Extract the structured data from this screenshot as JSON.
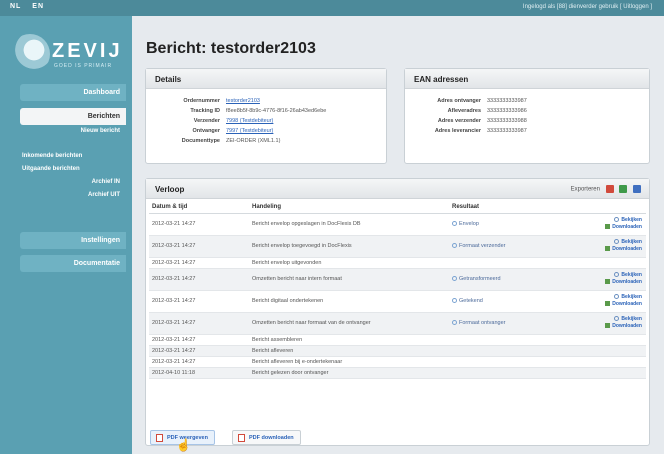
{
  "topbar": {
    "languages": [
      "NL",
      "EN"
    ],
    "userinfo": "Ingelogd als [88] dienverder gebruik [ Uitloggen ]"
  },
  "logo": {
    "name": "ZEVIJ",
    "tagline": "GOED IS PRIMAIR"
  },
  "sidebar": {
    "dashboard": "Dashboard",
    "berichten": "Berichten",
    "nieuw_bericht": "Nieuw bericht",
    "inkomende": "Inkomende berichten",
    "uitgaande": "Uitgaande berichten",
    "archief_in": "Archief IN",
    "archief_uit": "Archief UIT",
    "instellingen": "Instellingen",
    "documentatie": "Documentatie"
  },
  "page_title": "Bericht: testorder2103",
  "details": {
    "heading": "Details",
    "rows": [
      {
        "key": "Ordernummer",
        "value": "testorder2103",
        "link": true
      },
      {
        "key": "Tracking ID",
        "value": "f8ee8b5f-8b9c-4776-8f16-26ab43ed6ebe",
        "link": false
      },
      {
        "key": "Verzender",
        "value": "7998 (Testdebiteur)",
        "link": true
      },
      {
        "key": "Ontvanger",
        "value": "7997 (Testdebiteur)",
        "link": true
      },
      {
        "key": "Documenttype",
        "value": "ZEI-ORDER (XML1.1)",
        "link": false
      }
    ]
  },
  "ean": {
    "heading": "EAN adressen",
    "rows": [
      {
        "key": "Adres ontvanger",
        "value": "3333333333987"
      },
      {
        "key": "Afleveradres",
        "value": "3333333333986"
      },
      {
        "key": "Adres verzender",
        "value": "3333333333988"
      },
      {
        "key": "Adres leverancier",
        "value": "3333333333987"
      }
    ]
  },
  "verloop": {
    "heading": "Verloop",
    "export_label": "Exporteren",
    "columns": [
      "Datum & tijd",
      "Handeling",
      "Resultaat"
    ],
    "rows": [
      {
        "date": "2012-03-21 14:27",
        "action": "Bericht envelop opgeslagen in DocFlexis DB",
        "result": "Envelop",
        "actions": true
      },
      {
        "date": "2012-03-21 14:27",
        "action": "Bericht envelop toegevoegd in DocFlexis",
        "result": "Formaat verzender",
        "actions": true
      },
      {
        "date": "2012-03-21 14:27",
        "action": "Bericht envelop uitgevonden",
        "result": "",
        "actions": false
      },
      {
        "date": "2012-03-21 14:27",
        "action": "Omzetten bericht naar intern formaat",
        "result": "Getransformeerd",
        "actions": true
      },
      {
        "date": "2012-03-21 14:27",
        "action": "Bericht digitaal ondertekenen",
        "result": "Getekend",
        "actions": true
      },
      {
        "date": "2012-03-21 14:27",
        "action": "Omzetten bericht naar formaat van de ontvanger",
        "result": "Formaat ontvanger",
        "actions": true
      },
      {
        "date": "2012-03-21 14:27",
        "action": "Bericht assembleren",
        "result": "",
        "actions": false
      },
      {
        "date": "2012-03-21 14:27",
        "action": "Bericht afleveren",
        "result": "",
        "actions": false
      },
      {
        "date": "2012-03-21 14:27",
        "action": "Bericht afleveren bij e-ondertekenaar",
        "result": "",
        "actions": false
      },
      {
        "date": "2012-04-10 11:18",
        "action": "Bericht gelezen door ontvanger",
        "result": "",
        "actions": false
      }
    ],
    "action_labels": {
      "view": "Bekijken",
      "download": "Downloaden"
    }
  },
  "pdf": {
    "view": "PDF weergeven",
    "download": "PDF downloaden"
  }
}
